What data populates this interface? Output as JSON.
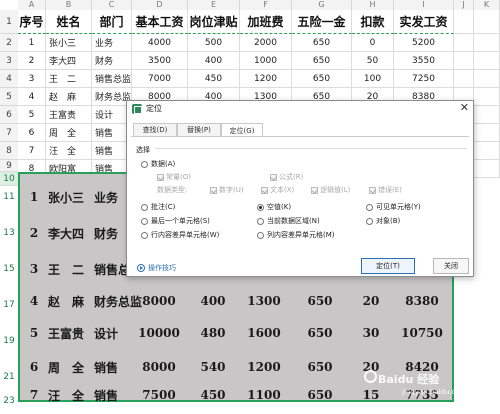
{
  "sheet": {
    "column_headers": [
      "A",
      "B",
      "C",
      "D",
      "E",
      "F",
      "G",
      "H",
      "I",
      "J",
      "K"
    ],
    "row_numbers": [
      "1",
      "2",
      "3",
      "4",
      "5",
      "6",
      "7",
      "8",
      "9",
      "10",
      "11",
      "13",
      "15",
      "17",
      "19",
      "21",
      "23"
    ],
    "table_headers": [
      "序号",
      "姓名",
      "部门",
      "基本工资",
      "岗位津贴",
      "加班费",
      "五险一金",
      "扣款",
      "实发工资"
    ],
    "rows": [
      [
        "1",
        "张小三",
        "业务",
        "4000",
        "500",
        "2000",
        "650",
        "0",
        "5200"
      ],
      [
        "2",
        "李大四",
        "财务",
        "3500",
        "400",
        "1000",
        "650",
        "50",
        "3550"
      ],
      [
        "3",
        "王　二",
        "销售总监",
        "7000",
        "450",
        "1200",
        "650",
        "100",
        "7250"
      ],
      [
        "4",
        "赵　麻",
        "财务总监",
        "8000",
        "400",
        "1300",
        "650",
        "20",
        "8380"
      ],
      [
        "5",
        "王富贵",
        "设计",
        "",
        "",
        "",
        "",
        "",
        ""
      ],
      [
        "6",
        "周　全",
        "销售",
        "",
        "",
        "",
        "",
        "",
        ""
      ],
      [
        "7",
        "汪　全",
        "销售",
        "",
        "",
        "",
        "",
        "",
        ""
      ],
      [
        "8",
        "欧阳富",
        "销售",
        "",
        "",
        "",
        "",
        "",
        ""
      ]
    ],
    "selected_rows": [
      [
        "1",
        "张小三",
        "业务",
        "",
        "",
        "",
        "",
        "",
        ""
      ],
      [
        "2",
        "李大四",
        "财务",
        "",
        "",
        "",
        "",
        "",
        ""
      ],
      [
        "3",
        "王　二",
        "销售总",
        "",
        "",
        "",
        "",
        "",
        ""
      ],
      [
        "4",
        "赵　麻",
        "财务总监",
        "8000",
        "400",
        "1300",
        "650",
        "20",
        "8380"
      ],
      [
        "5",
        "王富贵",
        "设计",
        "10000",
        "480",
        "1600",
        "650",
        "30",
        "10750"
      ],
      [
        "6",
        "周　全",
        "销售",
        "8000",
        "540",
        "1200",
        "650",
        "20",
        "8420"
      ],
      [
        "7",
        "汪　全",
        "销售",
        "7500",
        "450",
        "1100",
        "650",
        "15",
        "7735"
      ]
    ],
    "selection_border_color": "#28a05a",
    "selection_fill_color": "#c8c6c6"
  },
  "dialog": {
    "title": "定位",
    "close_glyph": "✕",
    "tabs": [
      "查找(D)",
      "替换(P)",
      "定位(G)"
    ],
    "active_tab": "定位(G)",
    "section_label": "选择",
    "options": {
      "data": "数据(A)",
      "constant": "常量(O)",
      "formula": "公式(R)",
      "data_type_label": "数据类型:",
      "number": "数字(U)",
      "text": "文本(X)",
      "logical": "逻辑值(L)",
      "error": "错误(E)",
      "comment": "批注(C)",
      "blank": "空值(K)",
      "visible_cells": "可见单元格(Y)",
      "last_cell": "最后一个单元格(S)",
      "current_region": "当前数据区域(N)",
      "objects": "对象(B)",
      "row_diff": "行内容差异单元格(W)",
      "col_diff": "列内容差异单元格(M)"
    },
    "selected_option": "空值(K)",
    "tips_link": "操作技巧",
    "locate_button": "定位(T)",
    "close_button": "关闭"
  },
  "watermark": {
    "text": "Baidu 经验",
    "subtext": "jingyan.baidu.com"
  }
}
